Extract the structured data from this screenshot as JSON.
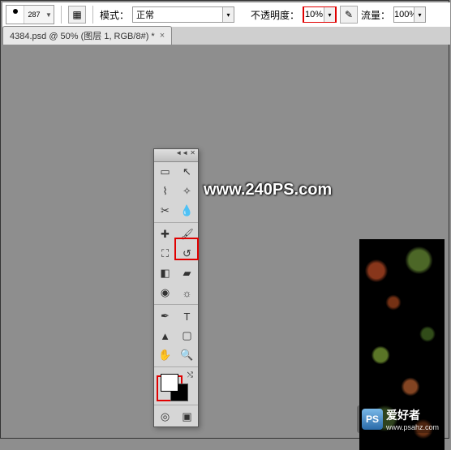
{
  "options_bar": {
    "brush_size": "287",
    "mode_label": "模式：",
    "mode_value": "正常",
    "opacity_label": "不透明度：",
    "opacity_value": "10%",
    "flow_label": "流量：",
    "flow_value": "100%"
  },
  "tab": {
    "title": "4384.psd @ 50% (图层 1, RGB/8#) *",
    "close": "×"
  },
  "toolbox": {
    "collapse": "◄◄  ✕",
    "tools": [
      [
        "rect-marquee-icon",
        "move-icon"
      ],
      [
        "lasso-icon",
        "magic-wand-icon"
      ],
      [
        "crop-icon",
        "eyedropper-icon"
      ],
      [
        "healing-brush-icon",
        "brush-icon"
      ],
      [
        "clone-stamp-icon",
        "history-brush-icon"
      ],
      [
        "eraser-icon",
        "paint-bucket-icon"
      ],
      [
        "blur-icon",
        "dodge-icon"
      ],
      [
        "pen-icon",
        "type-icon"
      ],
      [
        "path-select-icon",
        "shape-icon"
      ],
      [
        "hand-icon",
        "zoom-icon"
      ]
    ],
    "glyphs": {
      "rect-marquee-icon": "▭",
      "move-icon": "↖",
      "lasso-icon": "⌇",
      "magic-wand-icon": "✧",
      "crop-icon": "✂",
      "eyedropper-icon": "💧",
      "healing-brush-icon": "✚",
      "brush-icon": "🖌",
      "clone-stamp-icon": "⛶",
      "history-brush-icon": "↺",
      "eraser-icon": "◧",
      "paint-bucket-icon": "▰",
      "blur-icon": "◉",
      "dodge-icon": "☼",
      "pen-icon": "✒",
      "type-icon": "T",
      "path-select-icon": "▲",
      "shape-icon": "▢",
      "hand-icon": "✋",
      "zoom-icon": "🔍",
      "quick-mask-icon": "◎",
      "screen-mode-icon": "▣"
    },
    "foreground_color": "#ffffff",
    "background_color": "#000000"
  },
  "watermark": {
    "url": "www.240PS.com"
  },
  "footer": {
    "badge": "PS",
    "name": "爱好者",
    "site": "www.psahz.com"
  }
}
